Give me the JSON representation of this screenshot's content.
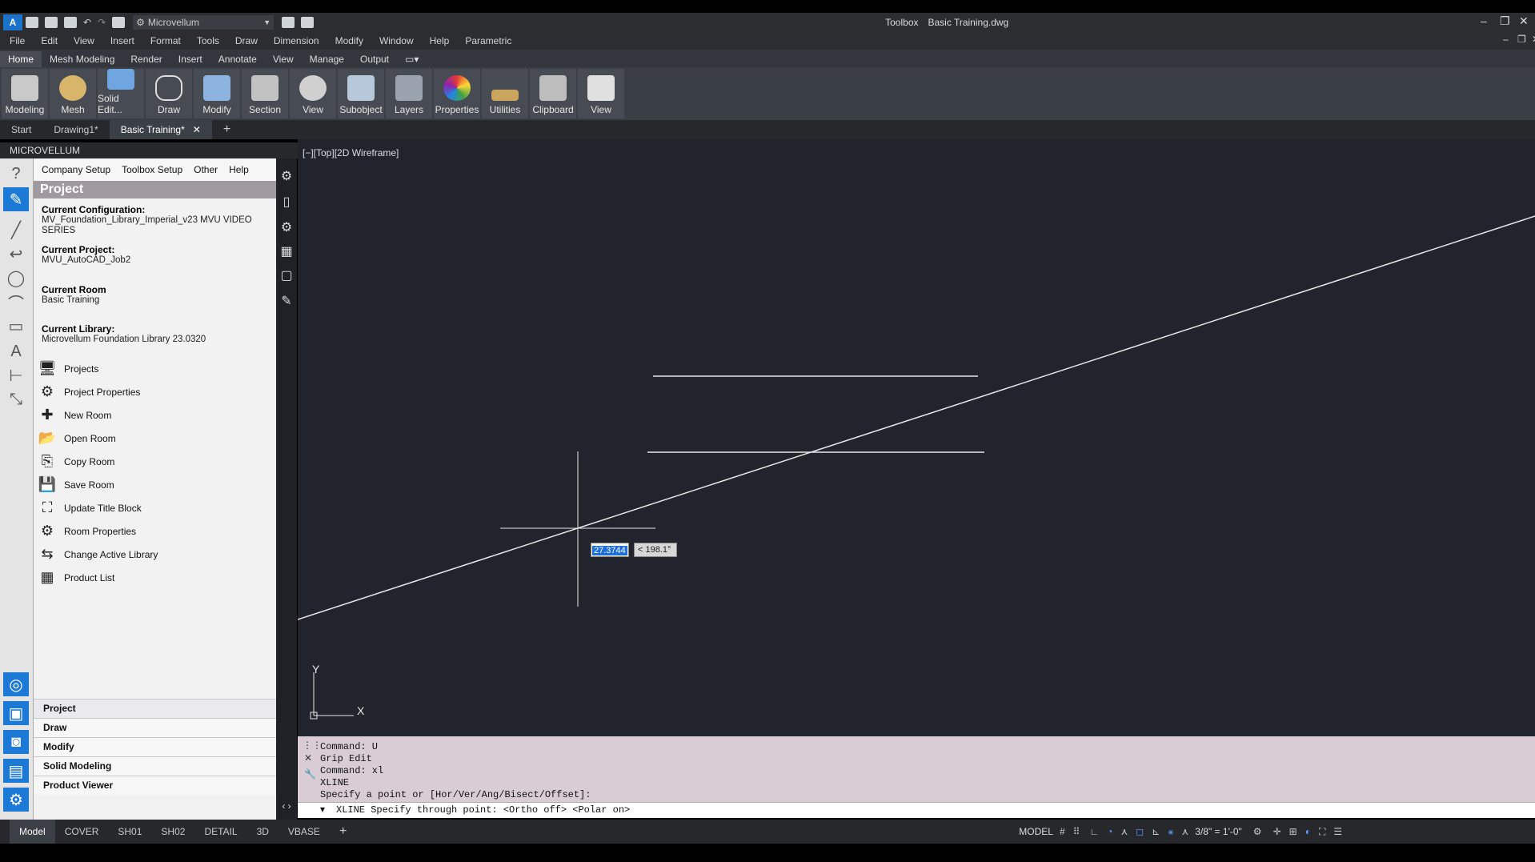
{
  "app": {
    "workspace": "Microvellum",
    "toolbox": "Toolbox",
    "file": "Basic Training.dwg"
  },
  "menu": [
    "File",
    "Edit",
    "View",
    "Insert",
    "Format",
    "Tools",
    "Draw",
    "Dimension",
    "Modify",
    "Window",
    "Help",
    "Parametric"
  ],
  "ribbon_tabs": [
    "Home",
    "Mesh Modeling",
    "Render",
    "Insert",
    "Annotate",
    "View",
    "Manage",
    "Output"
  ],
  "ribbon_buttons": [
    "Modeling",
    "Mesh",
    "Solid Edit...",
    "Draw",
    "Modify",
    "Section",
    "View",
    "Subobject",
    "Layers",
    "Properties",
    "Utilities",
    "Clipboard",
    "View"
  ],
  "doc_tabs": [
    "Start",
    "Drawing1*",
    "Basic Training*"
  ],
  "doc_tab_add": "+",
  "palette_title": "MICROVELLUM",
  "panel": {
    "menu": [
      "Company Setup",
      "Toolbox Setup",
      "Other",
      "Help"
    ],
    "title": "Project",
    "config_label": "Current Configuration:",
    "config_value": "MV_Foundation_Library_Imperial_v23 MVU VIDEO SERIES",
    "project_label": "Current Project:",
    "project_value": "MVU_AutoCAD_Job2",
    "room_label": "Current Room",
    "room_value": "Basic Training",
    "library_label": "Current Library:",
    "library_value": "Microvellum Foundation Library 23.0320",
    "items": [
      "Projects",
      "Project Properties",
      "New Room",
      "Open Room",
      "Copy Room",
      "Save Room",
      "Update Title Block",
      "Room Properties",
      "Change Active Library",
      "Product List"
    ],
    "accordion": [
      "Project",
      "Draw",
      "Modify",
      "Solid Modeling",
      "Product Viewer"
    ]
  },
  "viewport": {
    "label": "[−][Top][2D Wireframe]",
    "dyn_length": "27.3744",
    "dyn_angle": "< 198.1°",
    "ucs_x": "X",
    "ucs_y": "Y"
  },
  "command_history": [
    "Command:  U",
    "Grip Edit",
    "Command: xl",
    "XLINE",
    "Specify a point or [Hor/Ver/Ang/Bisect/Offset]:"
  ],
  "command_prompt": "XLINE Specify through point:  <Ortho off>  <Polar on>",
  "layout_tabs": [
    "Model",
    "COVER",
    "SH01",
    "SH02",
    "DETAIL",
    "3D",
    "VBASE"
  ],
  "layout_add": "+",
  "status": {
    "model": "MODEL",
    "scale": "3/8\" = 1'-0\""
  },
  "colors": {
    "viewport_bg": "#21242d",
    "command_bg": "#d9ccd4",
    "panel_header": "#a09a9e"
  }
}
